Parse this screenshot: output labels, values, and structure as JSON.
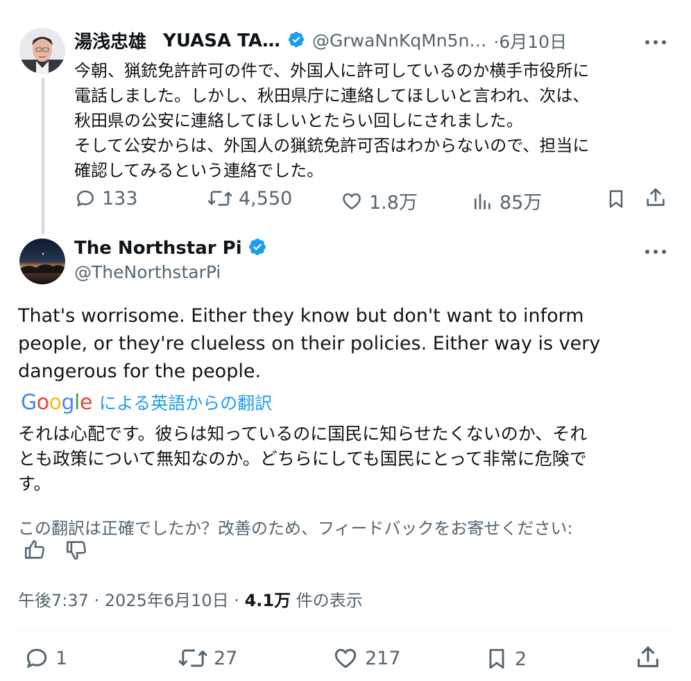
{
  "tweet1": {
    "author_name": "湯浅忠雄",
    "author_name_latin": "YUASA TA…",
    "handle": "@GrwaNnKqMn5n…",
    "date": "·6月10日",
    "text_lines": [
      "今朝、猟銃免許許可の件で、外国人に許可しているのか横手市役所に",
      "電話しました。しかし、秋田県庁に連絡してほしいと言われ、次は、",
      "秋田県の公安に連絡してほしいとたらい回しにされました。",
      "そして公安からは、外国人の猟銃免許可否はわからないので、担当に",
      "確認してみるという連絡でした。"
    ],
    "replies": "133",
    "retweets": "4,550",
    "likes": "1.8万",
    "views": "85万"
  },
  "tweet2": {
    "author_name": "The Northstar Pi",
    "handle": "@TheNorthstarPi",
    "text_lines": [
      "That's worrisome. Either they know but don't want to inform",
      "people, or they're clueless on their policies. Either way is very",
      "dangerous for the people."
    ],
    "google_logo": "Google",
    "translated_by": "による英語からの翻訳",
    "translation_lines": [
      "それは心配です。彼らは知っているのに国民に知らせたくないのか、それ",
      "とも政策について無知なのか。どちらにしても国民にとって非常に危険で",
      "す。"
    ],
    "feedback_prompt": "この翻訳は正確でしたか？改善のため、フィードバックをお寄せください:",
    "timestamp_prefix": "午後7:37 · 2025年6月10日 ·",
    "views_count": "4.1万",
    "views_suffix": "件の表示",
    "replies": "1",
    "retweets": "27",
    "likes": "217",
    "bookmarks": "2"
  },
  "colors": {
    "text": "#0f1419",
    "muted": "#536471",
    "verified": "#1d9bf0",
    "link": "#1d9bf0",
    "thread_line": "#cfd9de"
  },
  "icons": {
    "verified": "verified-badge-icon",
    "more": "more-dots-icon",
    "reply": "reply-bubble-icon",
    "retweet": "retweet-arrows-icon",
    "like": "heart-icon",
    "views": "bar-chart-icon",
    "bookmark": "bookmark-icon",
    "share": "share-upload-icon",
    "thumbs_up": "thumbs-up-icon",
    "thumbs_down": "thumbs-down-icon"
  }
}
